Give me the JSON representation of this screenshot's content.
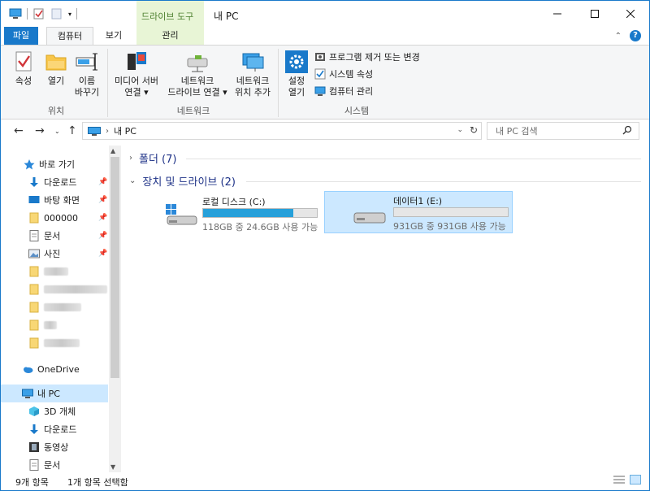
{
  "window": {
    "title": "내 PC",
    "context_tab": "드라이브 도구"
  },
  "tabs": {
    "file": "파일",
    "computer": "컴퓨터",
    "view": "보기",
    "manage": "관리"
  },
  "ribbon": {
    "properties": "속성",
    "open": "열기",
    "rename_line1": "이름",
    "rename_line2": "바꾸기",
    "location_group": "위치",
    "media_server_line1": "미디어 서버",
    "media_server_line2": "연결 ▾",
    "map_drive_line1": "네트워크",
    "map_drive_line2": "드라이브 연결 ▾",
    "add_location_line1": "네트워크",
    "add_location_line2": "위치 추가",
    "network_group": "네트워크",
    "settings_line1": "설정",
    "settings_line2": "열기",
    "uninstall": "프로그램 제거 또는 변경",
    "system_props": "시스템 속성",
    "manage": "컴퓨터 관리",
    "system_group": "시스템"
  },
  "address": {
    "crumb": "내 PC",
    "search_placeholder": "내 PC 검색"
  },
  "sidebar": {
    "quick_access": "바로 가기",
    "downloads": "다운로드",
    "desktop": "바탕 화면",
    "folder_000000": "000000",
    "documents": "문서",
    "pictures": "사진",
    "onedrive": "OneDrive",
    "this_pc": "내 PC",
    "objects3d": "3D 개체",
    "downloads2": "다운로드",
    "videos": "동영상",
    "documents2": "문서"
  },
  "content": {
    "folders_header": "폴더 (7)",
    "devices_header": "장치 및 드라이브 (2)",
    "drives": [
      {
        "name": "로컬 디스크 (C:)",
        "info": "118GB 중 24.6GB 사용 가능",
        "used_fraction": 0.79
      },
      {
        "name": "데이터1 (E:)",
        "info": "931GB 중 931GB 사용 가능",
        "used_fraction": 0.0
      }
    ]
  },
  "status": {
    "count": "9개 항목",
    "selected": "1개 항목 선택함"
  },
  "colors": {
    "accent": "#1979ca",
    "selection": "#cce8ff",
    "drive_bar": "#26a0da",
    "context_tab": "#e8f5d6"
  }
}
